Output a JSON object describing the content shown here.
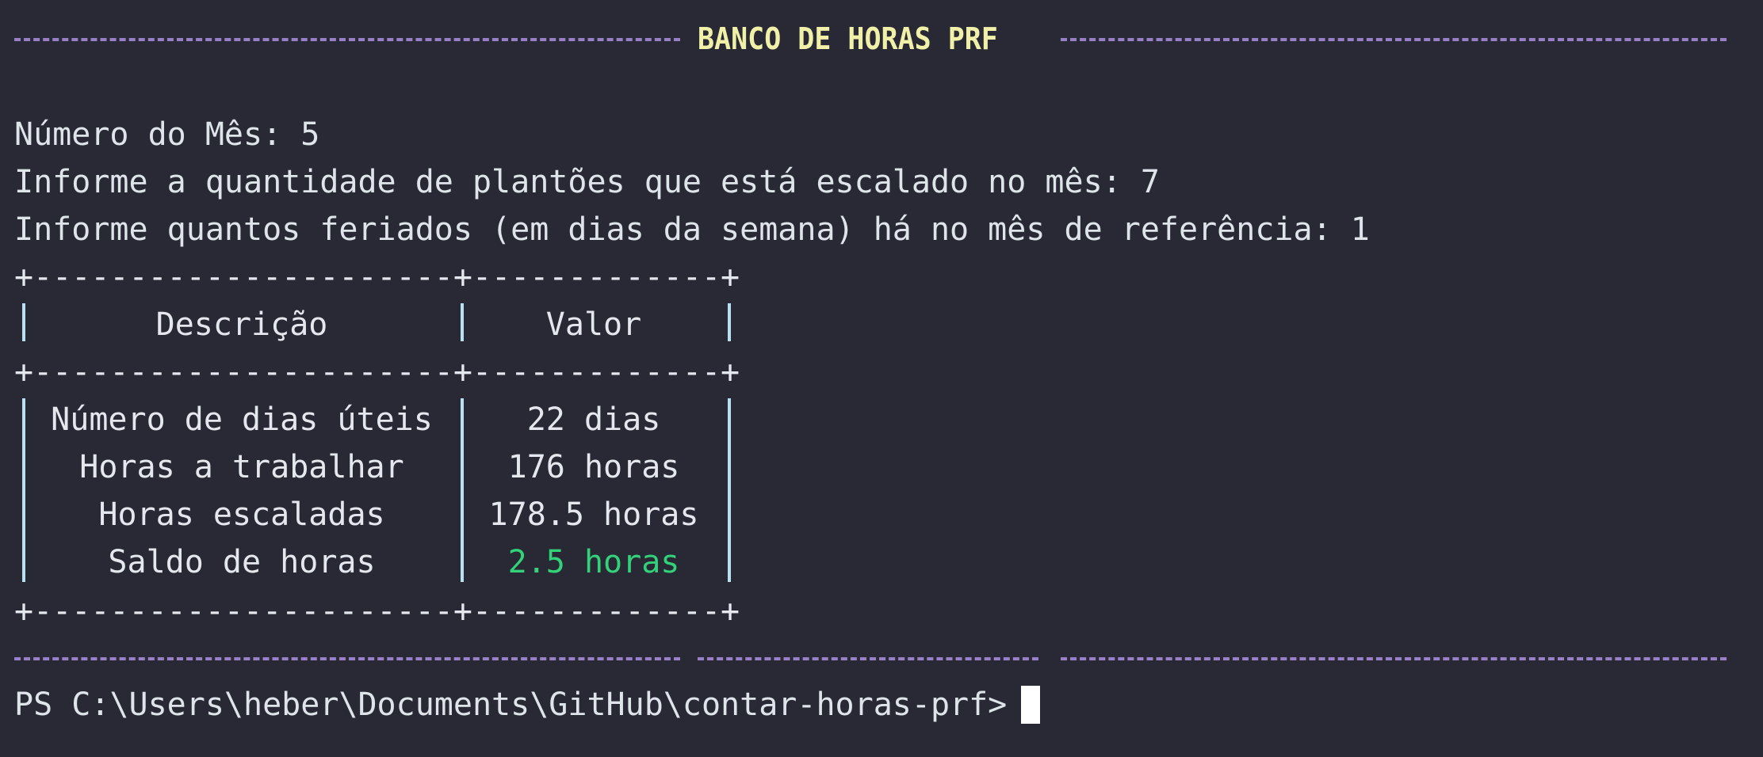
{
  "banner": {
    "title": "BANCO DE HORAS PRF"
  },
  "inputs": {
    "month_line": "Número do Mês: 5",
    "shifts_line": "Informe a quantidade de plantões que está escalado no mês: 7",
    "holidays_line": "Informe quantos feriados (em dias da semana) há no mês de referência: 1"
  },
  "table": {
    "border": "+----------------------+-------------+",
    "headers": [
      "Descrição",
      "Valor"
    ],
    "rows": [
      {
        "label": "Número de dias úteis",
        "value": "22 dias"
      },
      {
        "label": "Horas a trabalhar",
        "value": "176 horas"
      },
      {
        "label": "Horas escaladas",
        "value": "178.5 horas"
      },
      {
        "label": "Saldo de horas",
        "value": "2.5 horas"
      }
    ]
  },
  "prompt": {
    "text": "PS C:\\Users\\heber\\Documents\\GitHub\\contar-horas-prf>"
  },
  "colors": {
    "background": "#282935",
    "rule": "#a58ad6",
    "banner_title": "#f0f0a8",
    "positive_value": "#33d17a"
  }
}
